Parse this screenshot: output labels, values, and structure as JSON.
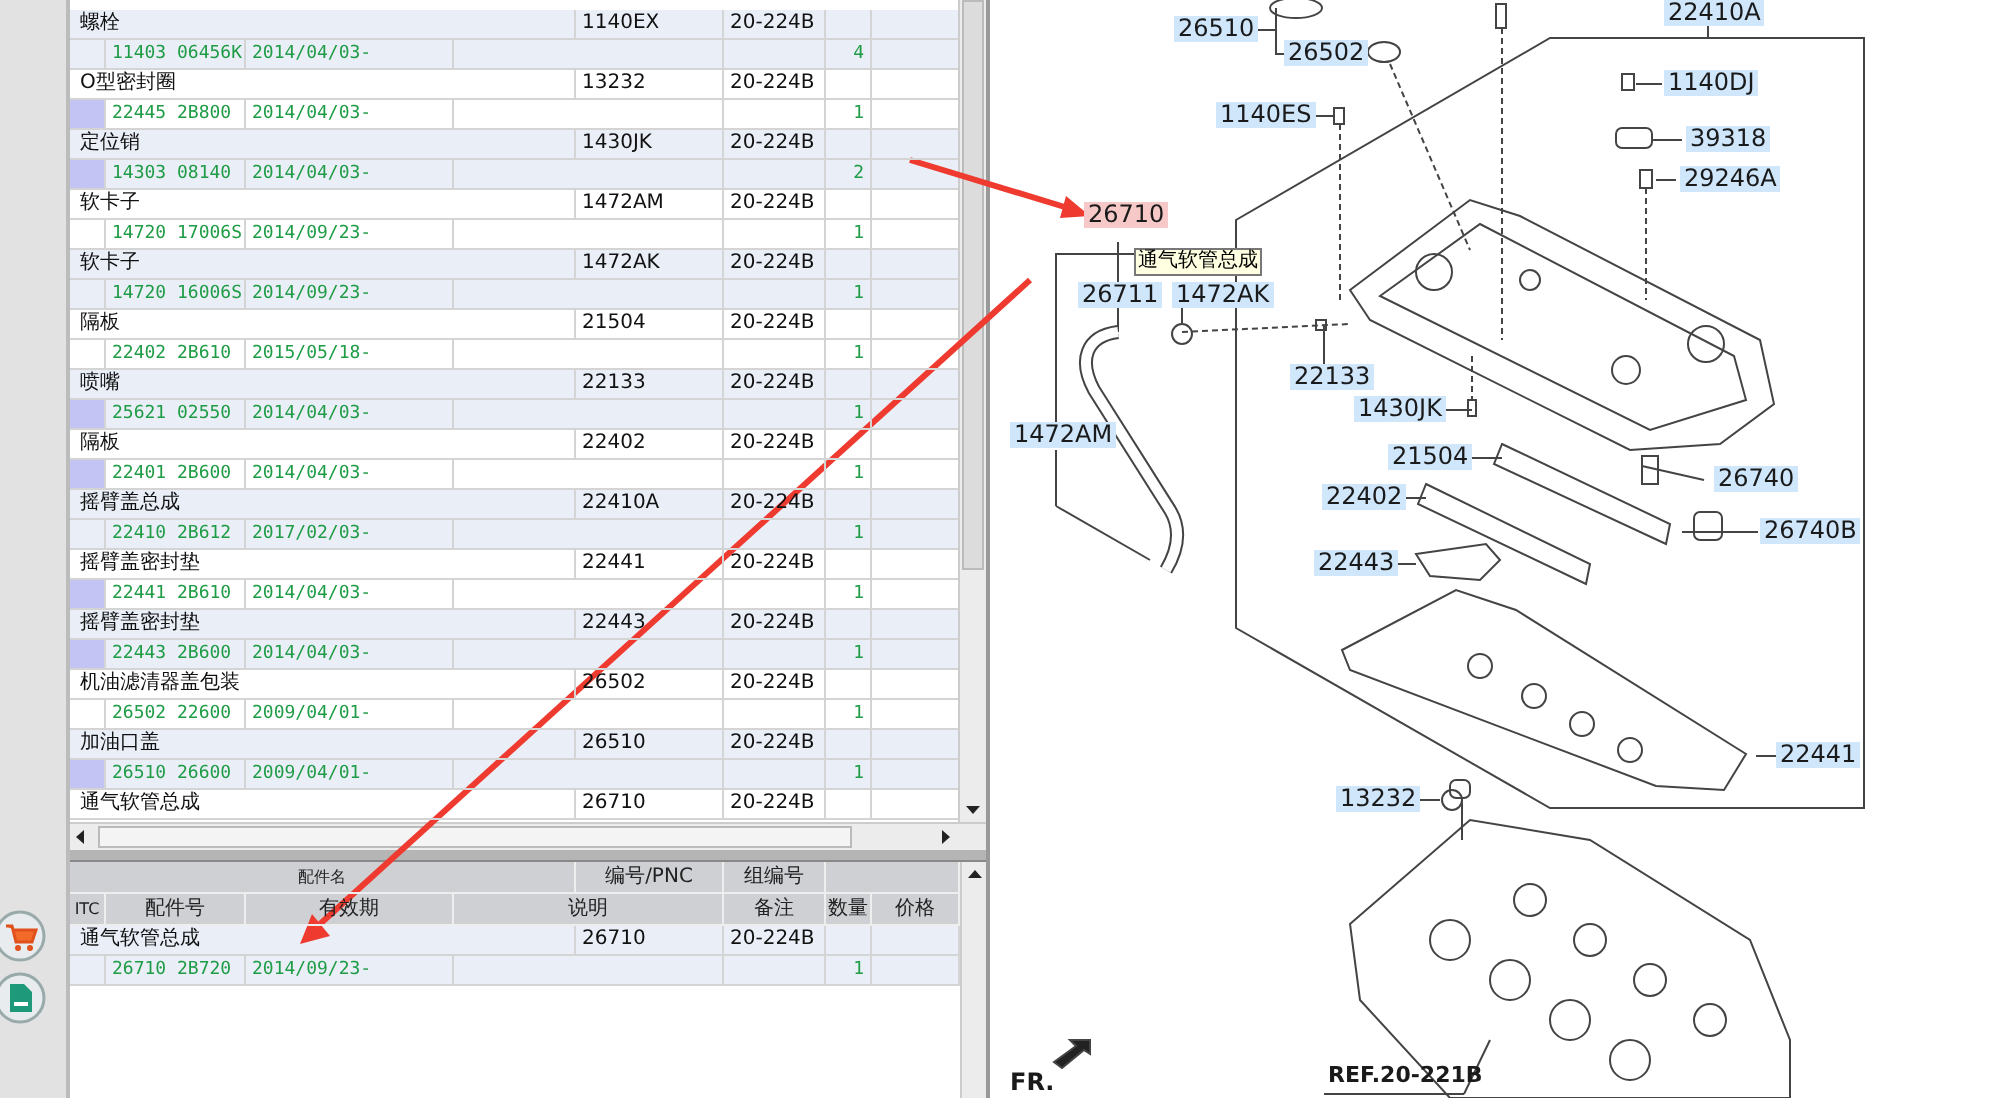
{
  "parts_list": {
    "rows": [
      {
        "name": "螺栓",
        "pnc": "1140EX",
        "group": "20-224B",
        "itc_marked": false,
        "part_no": "11403 06456K",
        "date": "2014/04/03-",
        "qty": "4"
      },
      {
        "name": "O型密封圈",
        "pnc": "13232",
        "group": "20-224B",
        "itc_marked": true,
        "part_no": "22445 2B800",
        "date": "2014/04/03-",
        "qty": "1"
      },
      {
        "name": "定位销",
        "pnc": "1430JK",
        "group": "20-224B",
        "itc_marked": true,
        "part_no": "14303 08140",
        "date": "2014/04/03-",
        "qty": "2"
      },
      {
        "name": "软卡子",
        "pnc": "1472AM",
        "group": "20-224B",
        "itc_marked": false,
        "part_no": "14720 17006S",
        "date": "2014/09/23-",
        "qty": "1"
      },
      {
        "name": "软卡子",
        "pnc": "1472AK",
        "group": "20-224B",
        "itc_marked": false,
        "part_no": "14720 16006S",
        "date": "2014/09/23-",
        "qty": "1"
      },
      {
        "name": "隔板",
        "pnc": "21504",
        "group": "20-224B",
        "itc_marked": false,
        "part_no": "22402 2B610",
        "date": "2015/05/18-",
        "qty": "1"
      },
      {
        "name": "喷嘴",
        "pnc": "22133",
        "group": "20-224B",
        "itc_marked": true,
        "part_no": "25621 02550",
        "date": "2014/04/03-",
        "qty": "1"
      },
      {
        "name": "隔板",
        "pnc": "22402",
        "group": "20-224B",
        "itc_marked": true,
        "part_no": "22401 2B600",
        "date": "2014/04/03-",
        "qty": "1"
      },
      {
        "name": "摇臂盖总成",
        "pnc": "22410A",
        "group": "20-224B",
        "itc_marked": false,
        "part_no": "22410 2B612",
        "date": "2017/02/03-",
        "qty": "1"
      },
      {
        "name": "摇臂盖密封垫",
        "pnc": "22441",
        "group": "20-224B",
        "itc_marked": true,
        "part_no": "22441 2B610",
        "date": "2014/04/03-",
        "qty": "1"
      },
      {
        "name": "摇臂盖密封垫",
        "pnc": "22443",
        "group": "20-224B",
        "itc_marked": true,
        "part_no": "22443 2B600",
        "date": "2014/04/03-",
        "qty": "1"
      },
      {
        "name": "机油滤清器盖包装",
        "pnc": "26502",
        "group": "20-224B",
        "itc_marked": false,
        "part_no": "26502 22600",
        "date": "2009/04/01-",
        "qty": "1"
      },
      {
        "name": "加油口盖",
        "pnc": "26510",
        "group": "20-224B",
        "itc_marked": true,
        "part_no": "26510 26600",
        "date": "2009/04/01-",
        "qty": "1"
      },
      {
        "name": "通气软管总成",
        "pnc": "26710",
        "group": "20-224B"
      }
    ]
  },
  "selected_part": {
    "header_top": [
      "配件名",
      "编号/PNC",
      "组编号"
    ],
    "header_bottom": [
      "ITC",
      "配件号",
      "有效期",
      "说明",
      "备注",
      "数量",
      "价格"
    ],
    "rows": [
      {
        "name": "通气软管总成",
        "pnc": "26710",
        "group": "20-224B",
        "itc_marked": false,
        "part_no": "26710 2B720",
        "date": "2014/09/23-",
        "qty": "1"
      }
    ]
  },
  "diagram": {
    "callouts": [
      {
        "text": "26510",
        "kind": "label",
        "highlighted": false
      },
      {
        "text": "26502",
        "kind": "label",
        "highlighted": false
      },
      {
        "text": "22410A",
        "kind": "label",
        "highlighted": false
      },
      {
        "text": "1140ES",
        "kind": "label",
        "highlighted": false
      },
      {
        "text": "1140DJ",
        "kind": "label",
        "highlighted": false
      },
      {
        "text": "39318",
        "kind": "label",
        "highlighted": false
      },
      {
        "text": "29246A",
        "kind": "label",
        "highlighted": false
      },
      {
        "text": "26710",
        "kind": "label",
        "highlighted": true
      },
      {
        "text": "1472AK",
        "kind": "label",
        "highlighted": false
      },
      {
        "text": "26711",
        "kind": "label",
        "highlighted": false
      },
      {
        "text": "22133",
        "kind": "label",
        "highlighted": false
      },
      {
        "text": "1430JK",
        "kind": "label",
        "highlighted": false
      },
      {
        "text": "1472AM",
        "kind": "label",
        "highlighted": false
      },
      {
        "text": "21504",
        "kind": "label",
        "highlighted": false
      },
      {
        "text": "26740",
        "kind": "label",
        "highlighted": false
      },
      {
        "text": "22402",
        "kind": "label",
        "highlighted": false
      },
      {
        "text": "26740B",
        "kind": "label",
        "highlighted": false
      },
      {
        "text": "22443",
        "kind": "label",
        "highlighted": false
      },
      {
        "text": "22441",
        "kind": "label",
        "highlighted": false
      },
      {
        "text": "13232",
        "kind": "label",
        "highlighted": false
      },
      {
        "text": "REF.20-221B",
        "kind": "reference"
      },
      {
        "text": "FR.",
        "kind": "direction"
      }
    ],
    "tooltip": "通气软管总成"
  }
}
